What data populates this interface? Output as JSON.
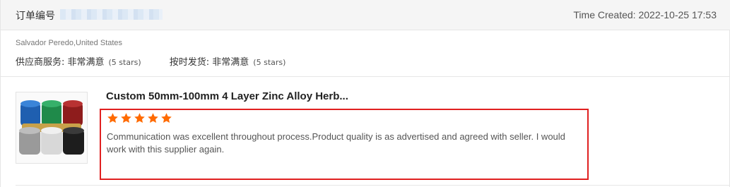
{
  "header": {
    "order_label": "订单编号",
    "time_created": "Time Created: 2022-10-25 17:53"
  },
  "buyer": {
    "name_country": "Salvador Peredo,United States",
    "ratings": [
      {
        "label": "供应商服务: 非常满意",
        "stars_text": "(5 stars)"
      },
      {
        "label": "按时发货: 非常满意",
        "stars_text": "(5 stars)"
      }
    ]
  },
  "product": {
    "title": "Custom 50mm-100mm 4 Layer Zinc Alloy Herb...",
    "image_icon": "grinder-product-icon"
  },
  "review": {
    "rating": 5,
    "star_color": "#ff6a00",
    "text": "Communication was excellent throughout process.Product quality is as advertised and agreed with seller. I would work with this supplier again."
  },
  "colors": {
    "header_bg": "#f5f5f5",
    "highlight_border": "#e02020",
    "star": "#ff6a00"
  }
}
